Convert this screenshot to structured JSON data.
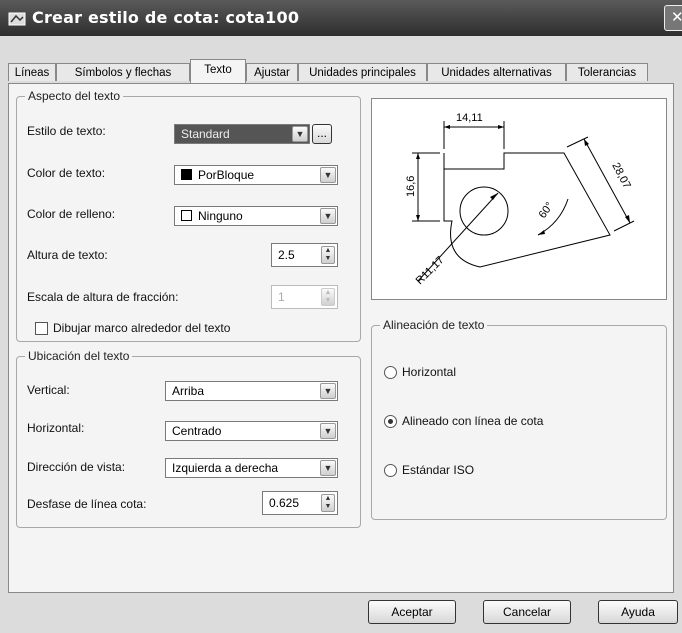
{
  "window": {
    "title": "Crear estilo de cota: cota100",
    "close_glyph": "✕"
  },
  "tabs": [
    "Líneas",
    "Símbolos y flechas",
    "Texto",
    "Ajustar",
    "Unidades principales",
    "Unidades alternativas",
    "Tolerancias"
  ],
  "active_tab": "Texto",
  "aspecto": {
    "legend": "Aspecto del texto",
    "estilo_label": "Estilo de texto:",
    "estilo_value": "Standard",
    "estilo_more": "...",
    "color_label": "Color de texto:",
    "color_value": "PorBloque",
    "relleno_label": "Color de relleno:",
    "relleno_value": "Ninguno",
    "altura_label": "Altura de texto:",
    "altura_value": "2.5",
    "escala_label": "Escala de altura de fracción:",
    "escala_value": "1",
    "marco_label": "Dibujar marco alrededor del texto",
    "marco_checked": false
  },
  "ubicacion": {
    "legend": "Ubicación del texto",
    "vertical_label": "Vertical:",
    "vertical_value": "Arriba",
    "horizontal_label": "Horizontal:",
    "horizontal_value": "Centrado",
    "direccion_label": "Dirección de vista:",
    "direccion_value": "Izquierda a derecha",
    "desfase_label": "Desfase de línea cota:",
    "desfase_value": "0.625"
  },
  "preview": {
    "dim_top": "14,11",
    "dim_left": "16,6",
    "dim_right": "28,07",
    "dim_angle": "60°",
    "dim_radius": "R11,17"
  },
  "alineacion": {
    "legend": "Alineación de texto",
    "options": [
      "Horizontal",
      "Alineado con línea de cota",
      "Estándar ISO"
    ],
    "selected": "Alineado con línea de cota"
  },
  "buttons": {
    "ok": "Aceptar",
    "cancel": "Cancelar",
    "help": "Ayuda"
  },
  "colors": {
    "titlebar": "#3f3f3f",
    "panel": "#f4f4f4",
    "swatch_porbloque": "#000000"
  }
}
